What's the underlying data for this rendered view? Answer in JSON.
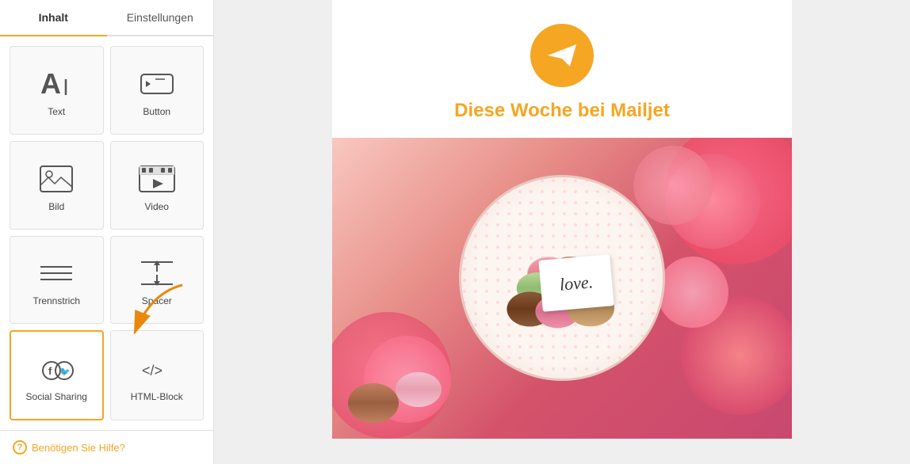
{
  "sidebar": {
    "tabs": [
      {
        "id": "inhalt",
        "label": "Inhalt",
        "active": true
      },
      {
        "id": "einstellungen",
        "label": "Einstellungen",
        "active": false
      }
    ],
    "widgets": [
      {
        "id": "text",
        "label": "Text",
        "icon": "text-icon",
        "selected": false
      },
      {
        "id": "button",
        "label": "Button",
        "icon": "button-icon",
        "selected": false
      },
      {
        "id": "bild",
        "label": "Bild",
        "icon": "image-icon",
        "selected": false
      },
      {
        "id": "video",
        "label": "Video",
        "icon": "video-icon",
        "selected": false
      },
      {
        "id": "trennstrich",
        "label": "Trennstrich",
        "icon": "divider-icon",
        "selected": false
      },
      {
        "id": "spacer",
        "label": "Spacer",
        "icon": "spacer-icon",
        "selected": false
      },
      {
        "id": "social-sharing",
        "label": "Social Sharing",
        "icon": "social-icon",
        "selected": true
      },
      {
        "id": "html-block",
        "label": "HTML-Block",
        "icon": "html-icon",
        "selected": false
      }
    ],
    "help_label": "Benötigen Sie Hilfe?"
  },
  "email": {
    "title": "Diese Woche bei Mailjet",
    "logo_alt": "Mailjet logo"
  },
  "colors": {
    "orange": "#f5a623",
    "selected_border": "#f5a623"
  }
}
